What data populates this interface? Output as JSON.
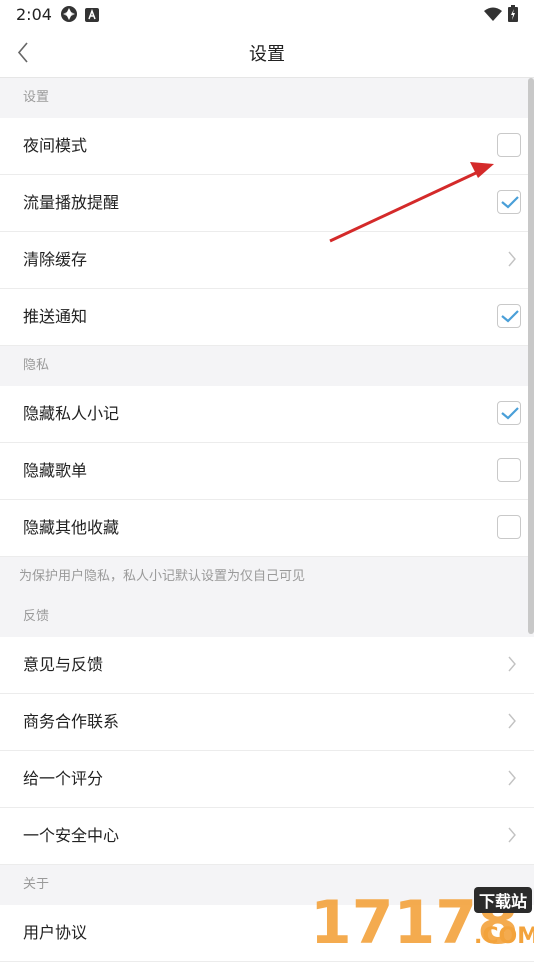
{
  "status_bar": {
    "time": "2:04",
    "icons": [
      "aperture-icon",
      "a-box-icon",
      "wifi-icon",
      "battery-charging-icon"
    ]
  },
  "nav": {
    "title": "设置",
    "back_icon": "chevron-left-icon"
  },
  "sections": {
    "settings": {
      "header": "设置",
      "night_mode": "夜间模式",
      "data_reminder": "流量播放提醒",
      "clear_cache": "清除缓存",
      "push": "推送通知"
    },
    "privacy": {
      "header": "隐私",
      "hide_notes": "隐藏私人小记",
      "hide_playlists": "隐藏歌单",
      "hide_favorites": "隐藏其他收藏",
      "note": "为保护用户隐私，私人小记默认设置为仅自己可见"
    },
    "feedback": {
      "header": "反馈",
      "suggestions": "意见与反馈",
      "business": "商务合作联系",
      "rate": "给一个评分",
      "security": "一个安全中心"
    },
    "about": {
      "header": "关于",
      "agreement": "用户协议"
    }
  },
  "toggles": {
    "night_mode": false,
    "data_reminder": true,
    "push": true,
    "hide_notes": true,
    "hide_playlists": false,
    "hide_favorites": false
  },
  "watermark": {
    "brand": "17178",
    "badge": "下载站",
    "domain": ".COM"
  },
  "colors": {
    "accent_check": "#4a9fd8",
    "annotation_arrow": "#d42a2a",
    "watermark_orange": "#f3a33c"
  }
}
